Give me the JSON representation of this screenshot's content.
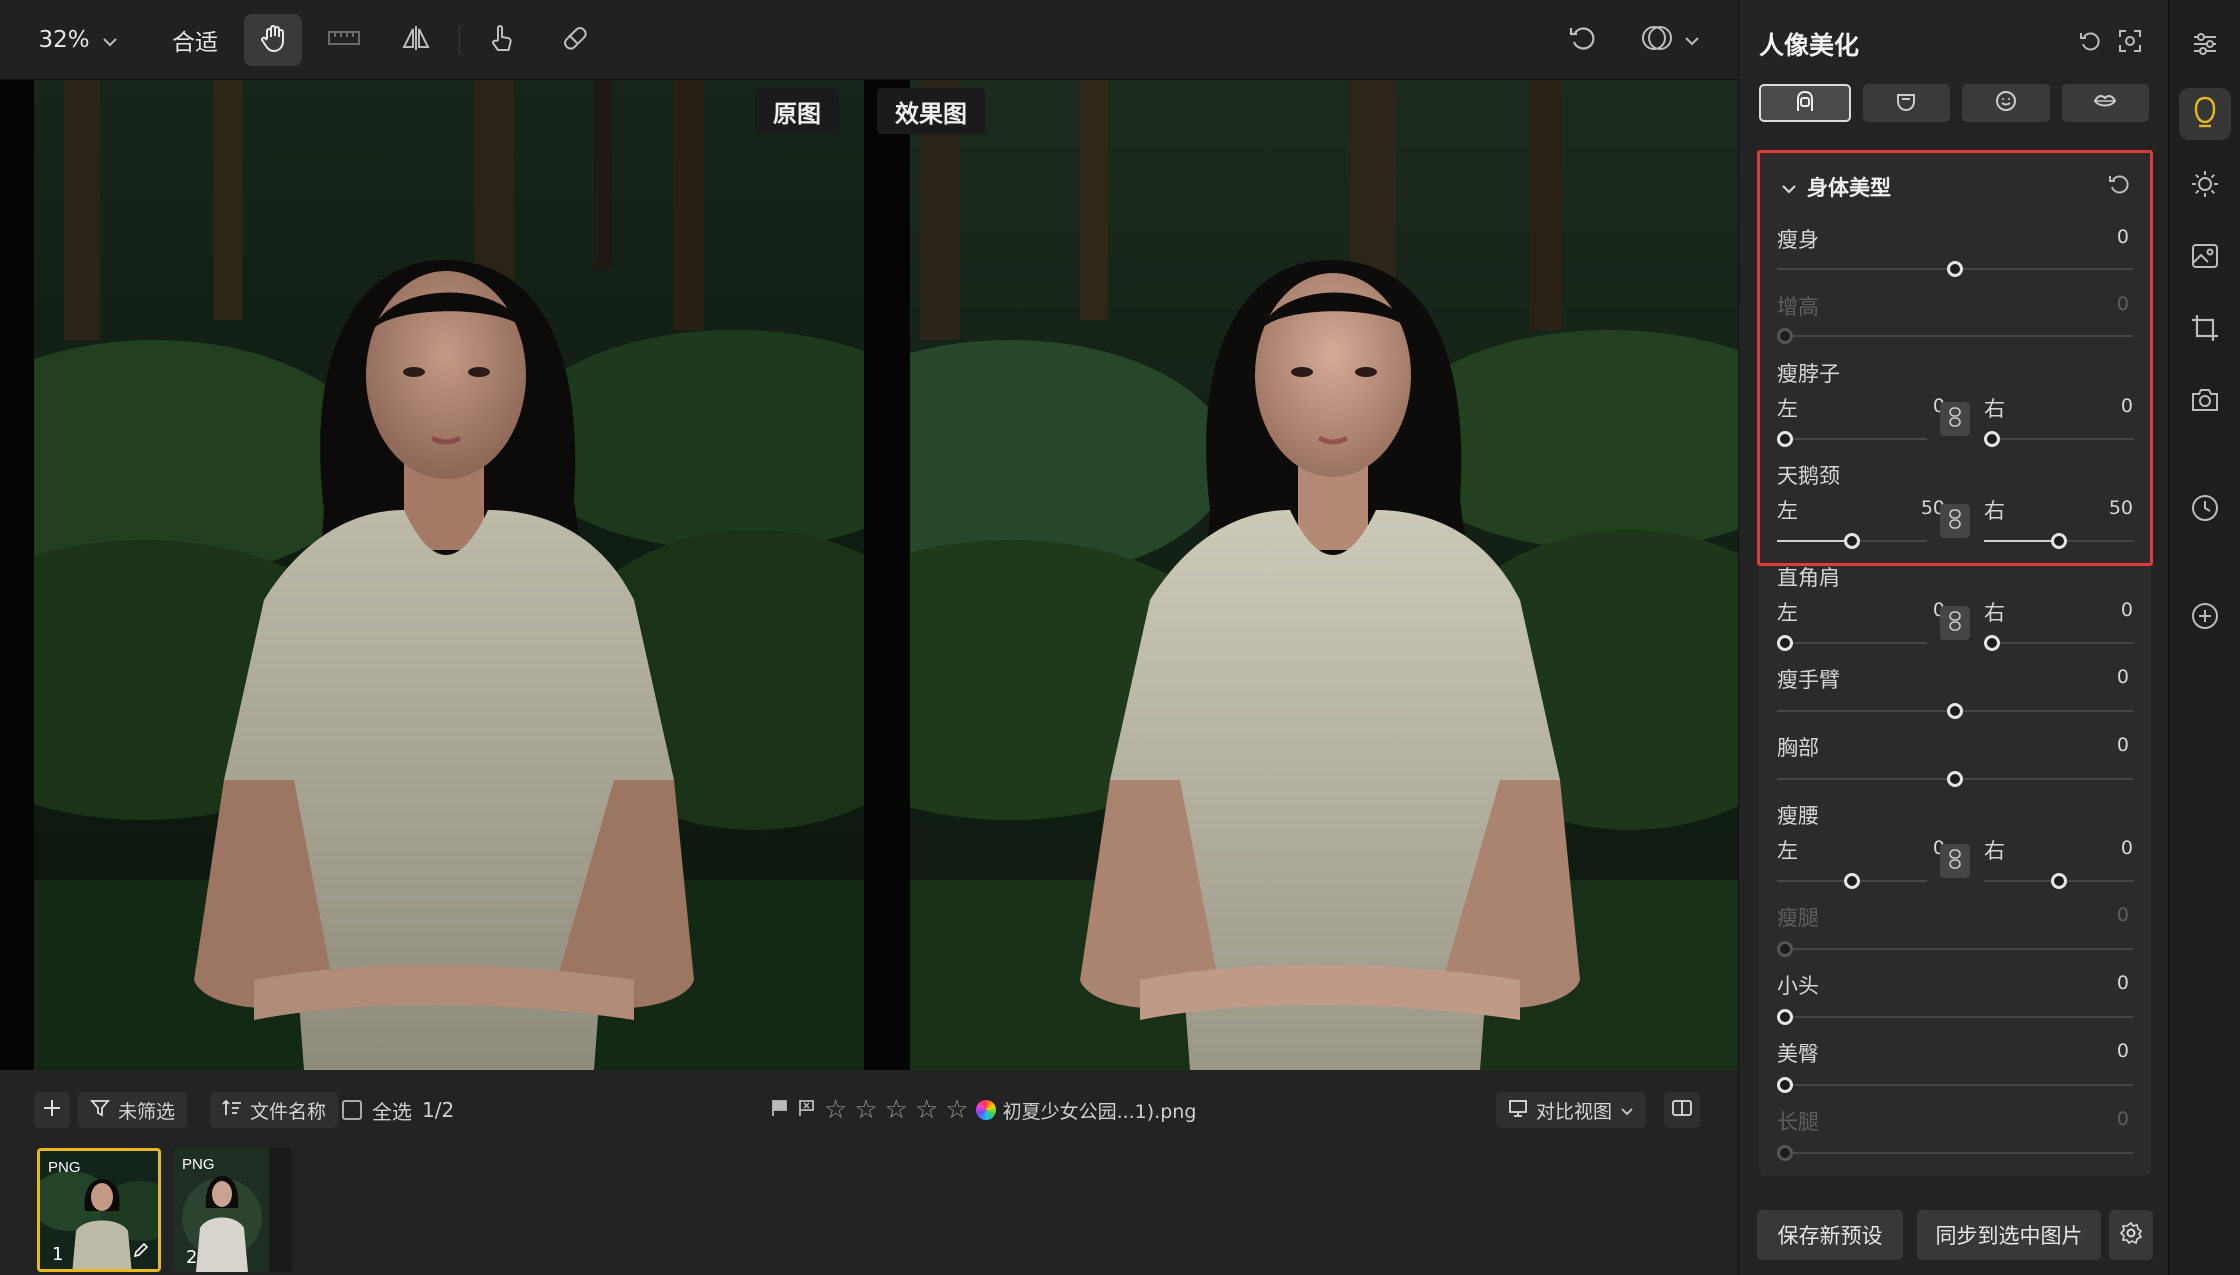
{
  "toolbar": {
    "zoom_label": "32%",
    "fit_label": "合适",
    "icons": [
      "hand-icon",
      "ruler-icon",
      "flip-icon",
      "touch-icon",
      "eraser-icon",
      "undo-icon",
      "compare-icon"
    ]
  },
  "canvas": {
    "before_label": "原图",
    "after_label": "效果图"
  },
  "filmstrip": {
    "filter_label": "未筛选",
    "sort_label": "文件名称",
    "select_all_label": "全选",
    "count": "1/2",
    "filename": "初夏少女公园...1).png",
    "view_mode_label": "对比视图",
    "thumbs": [
      {
        "format": "PNG",
        "index": "1"
      },
      {
        "format": "PNG",
        "index": "2"
      }
    ]
  },
  "panel": {
    "title": "人像美化",
    "section_title": "身体美型",
    "sliders": {
      "slim_body": {
        "label": "瘦身",
        "value": "0"
      },
      "taller": {
        "label": "增高",
        "value": "0"
      },
      "slim_neck": {
        "label": "瘦脖子",
        "left_label": "左",
        "right_label": "右",
        "left_value": "0",
        "right_value": "0"
      },
      "swan_neck": {
        "label": "天鹅颈",
        "left_label": "左",
        "right_label": "右",
        "left_value": "50",
        "right_value": "50"
      },
      "square_shoulder": {
        "label": "直角肩",
        "left_label": "左",
        "right_label": "右",
        "left_value": "0",
        "right_value": "0"
      },
      "slim_arm": {
        "label": "瘦手臂",
        "value": "0"
      },
      "chest": {
        "label": "胸部",
        "value": "0"
      },
      "slim_waist": {
        "label": "瘦腰",
        "left_label": "左",
        "right_label": "右",
        "left_value": "0",
        "right_value": "0"
      },
      "slim_leg": {
        "label": "瘦腿",
        "value": "0"
      },
      "small_head": {
        "label": "小头",
        "value": "0"
      },
      "hip": {
        "label": "美臀",
        "value": "0"
      },
      "long_leg": {
        "label": "长腿",
        "value": "0"
      }
    },
    "save_preset_label": "保存新预设",
    "sync_label": "同步到选中图片"
  },
  "colors": {
    "accent_yellow": "#e8b823",
    "highlight_red": "#e23a3a"
  }
}
